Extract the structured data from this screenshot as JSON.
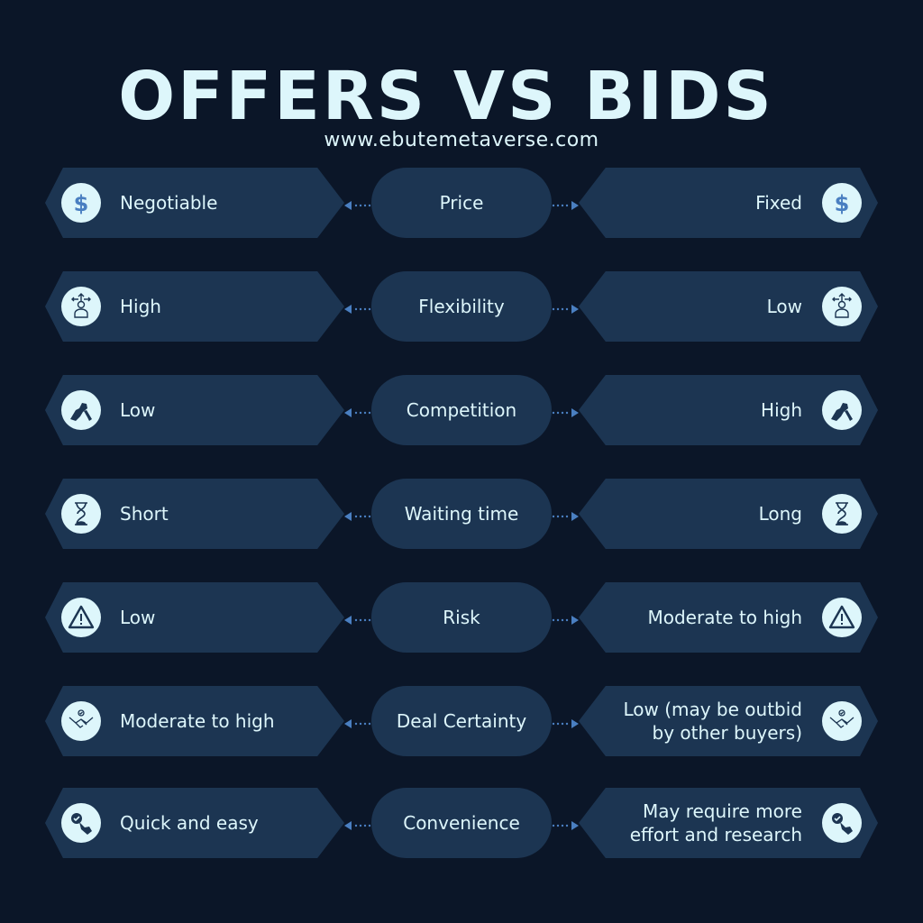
{
  "title": "OFFERS VS BIDS",
  "url": "www.ebutemetaverse.com",
  "colors": {
    "background": "#0b1628",
    "panel": "#1c3552",
    "text": "#ddf6fb",
    "accent": "#4a7fc1"
  },
  "rows": [
    {
      "criterion": "Price",
      "offers": "Negotiable",
      "bids": "Fixed",
      "icon": "dollar-icon"
    },
    {
      "criterion": "Flexibility",
      "offers": "High",
      "bids": "Low",
      "icon": "decision-person-icon"
    },
    {
      "criterion": "Competition",
      "offers": "Low",
      "bids": "High",
      "icon": "arm-wrestle-icon"
    },
    {
      "criterion": "Waiting time",
      "offers": "Short",
      "bids": "Long",
      "icon": "hourglass-icon"
    },
    {
      "criterion": "Risk",
      "offers": "Low",
      "bids": "Moderate to high",
      "icon": "warning-icon"
    },
    {
      "criterion": "Deal Certainty",
      "offers": "Moderate to high",
      "bids": "Low (may be outbid\nby other buyers)",
      "icon": "handshake-icon"
    },
    {
      "criterion": "Convenience",
      "offers": "Quick and easy",
      "bids": "May require more\neffort and research",
      "icon": "click-check-icon"
    }
  ]
}
